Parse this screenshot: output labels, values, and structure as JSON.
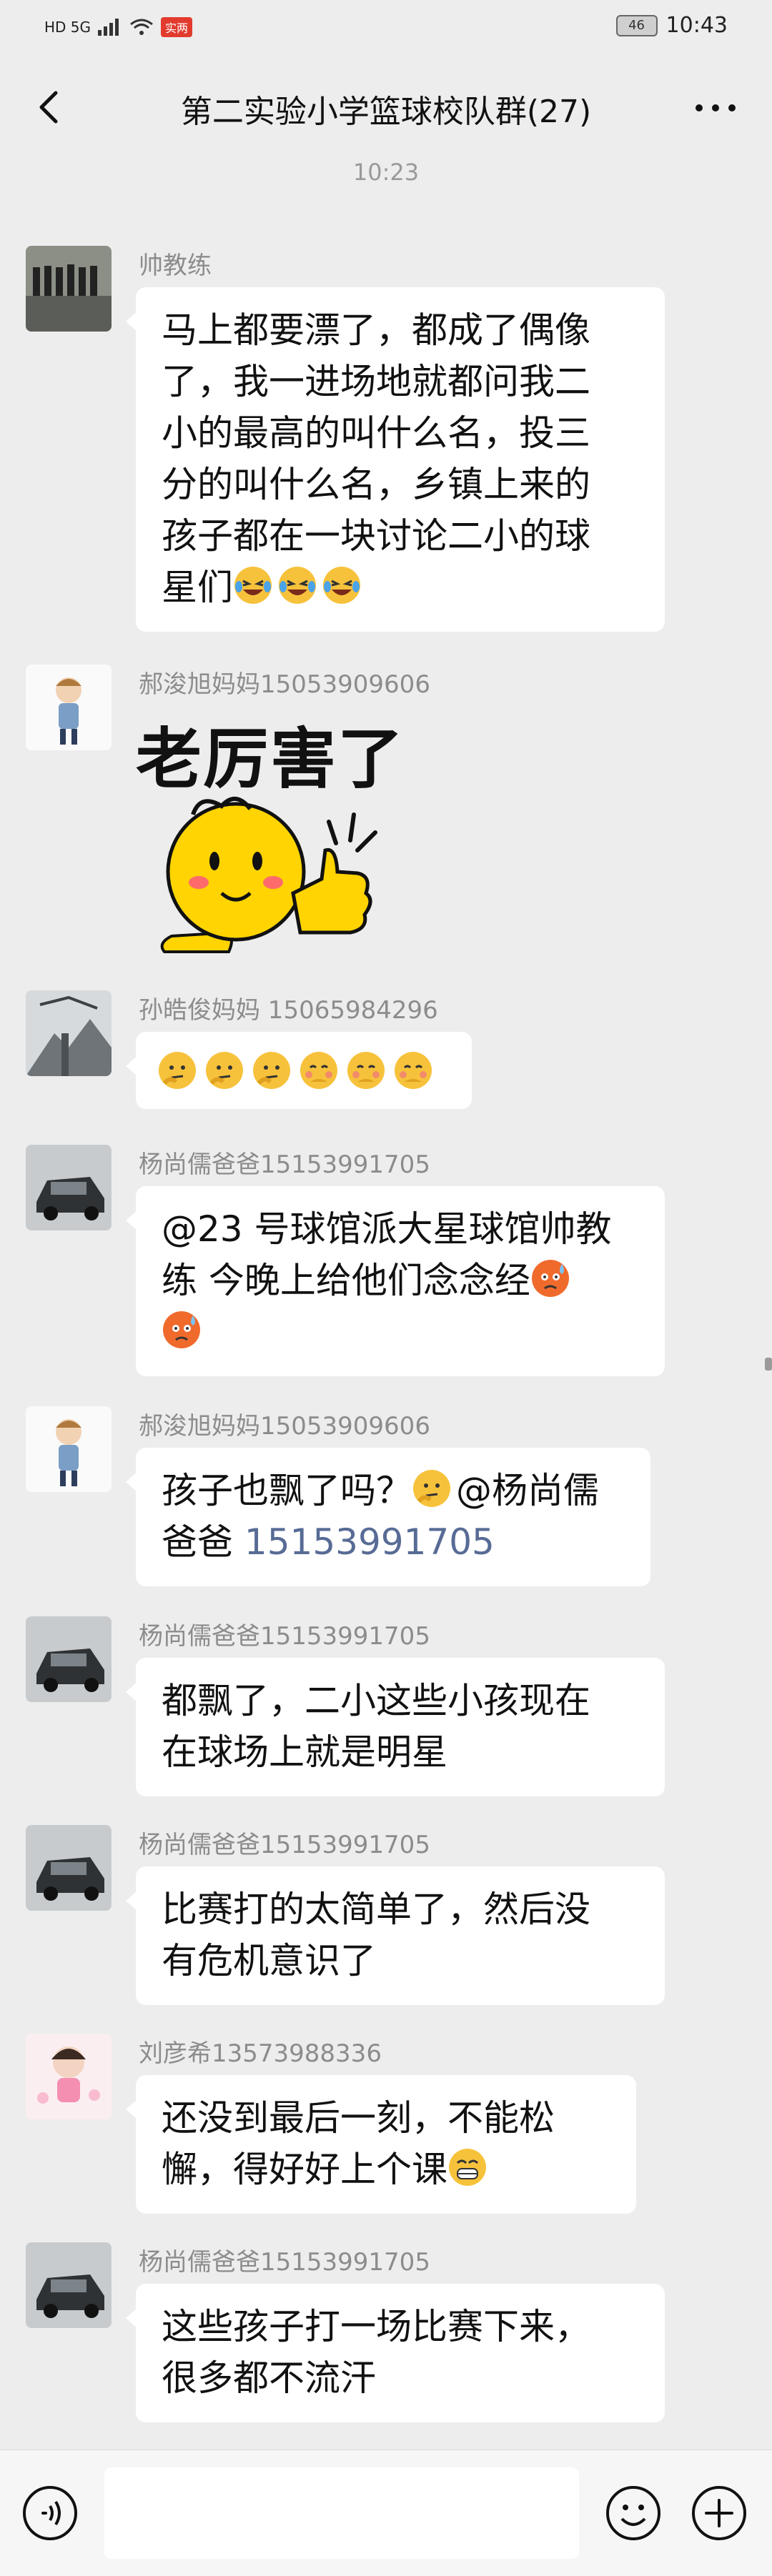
{
  "status_bar": {
    "network": "HD 5G",
    "tag": "实两",
    "battery": "46",
    "time": "10:43"
  },
  "header": {
    "title": "第二实验小学篮球校队群(27)"
  },
  "time_label": "10:23",
  "messages": [
    {
      "sender": "帅教练",
      "text": "马上都要漂了，都成了偶像了，我一进场地就都问我二小的最高的叫什么名，投三分的叫什么名，乡镇上来的孩子都在一块讨论二小的球星们",
      "line1": "马上都要漂了，都成了偶像",
      "line2": "了，我一进场地就都问我二",
      "line3": "小的最高的叫什么名，投三",
      "line4": "分的叫什么名，乡镇上来的",
      "line5": "孩子都在一块讨论二小的球",
      "line6": "星们",
      "emojis": [
        "laughing-tears-emoji",
        "laughing-tears-emoji",
        "laughing-tears-emoji"
      ]
    },
    {
      "sender": "郝浚旭妈妈15053909606",
      "sticker_text": "老厉害了",
      "sticker": "thumbs-up-smiley-sticker"
    },
    {
      "sender": "孙皓俊妈妈 15065984296",
      "emojis": [
        "thinking-emoji",
        "thinking-emoji",
        "thinking-emoji",
        "shy-emoji",
        "shy-emoji",
        "shy-emoji"
      ]
    },
    {
      "sender": "杨尚儒爸爸15153991705",
      "line1": "@23 号球馆派大星球馆帅教",
      "line2": "练  今晚上给他们念念经",
      "emojis": [
        "cold-sweat-emoji",
        "cold-sweat-emoji"
      ]
    },
    {
      "sender": "郝浚旭妈妈15053909606",
      "line1a": "孩子也飘了吗？",
      "line1b": "@杨尚儒",
      "line2a": "爸爸 ",
      "phone": "15153991705",
      "emojis": [
        "thinking-emoji"
      ]
    },
    {
      "sender": "杨尚儒爸爸15153991705",
      "line1": "都飘了，二小这些小孩现在",
      "line2": "在球场上就是明星"
    },
    {
      "sender": "杨尚儒爸爸15153991705",
      "line1": "比赛打的太简单了，然后没",
      "line2": "有危机意识了"
    },
    {
      "sender": "刘彦希13573988336",
      "line1": "还没到最后一刻，不能松",
      "line2": "懈，得好好上个课",
      "emojis": [
        "grin-emoji"
      ]
    },
    {
      "sender": "杨尚儒爸爸15153991705",
      "line1": "这些孩子打一场比赛下来，",
      "line2": "很多都不流汗"
    }
  ],
  "input_bar": {
    "placeholder": ""
  }
}
